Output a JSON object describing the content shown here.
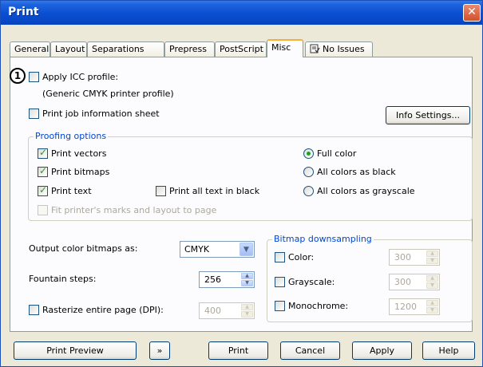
{
  "window": {
    "title": "Print",
    "close_glyph": "✕"
  },
  "tabs": [
    {
      "label": "General"
    },
    {
      "label": "Layout"
    },
    {
      "label": "Separations"
    },
    {
      "label": "Prepress"
    },
    {
      "label": "PostScript"
    },
    {
      "label": "Misc",
      "active": true
    },
    {
      "label": "No Issues",
      "icon": "issues-icon"
    }
  ],
  "marker": "1",
  "misc": {
    "apply_icc_label": "Apply ICC profile:",
    "apply_icc_checked": false,
    "icc_profile_name": "(Generic CMYK printer profile)",
    "print_job_info_label": "Print job information sheet",
    "print_job_info_checked": false,
    "info_settings_button": "Info Settings..."
  },
  "proofing": {
    "title": "Proofing options",
    "print_vectors": {
      "label": "Print vectors",
      "checked": true
    },
    "print_bitmaps": {
      "label": "Print bitmaps",
      "checked": true
    },
    "print_text": {
      "label": "Print text",
      "checked": true
    },
    "print_all_text_black": {
      "label": "Print all text in black",
      "checked": false
    },
    "fit_marks": {
      "label": "Fit printer's marks and layout to page",
      "checked": false,
      "disabled": true
    },
    "full_color": {
      "label": "Full color",
      "selected": true
    },
    "all_black": {
      "label": "All colors as black",
      "selected": false
    },
    "all_grayscale": {
      "label": "All colors as grayscale",
      "selected": false
    }
  },
  "output": {
    "bitmaps_label": "Output color bitmaps as:",
    "bitmaps_value": "CMYK",
    "fountain_label": "Fountain steps:",
    "fountain_value": "256",
    "rasterize_label": "Rasterize entire page (DPI):",
    "rasterize_checked": false,
    "rasterize_value": "400"
  },
  "downsampling": {
    "title": "Bitmap downsampling",
    "color": {
      "label": "Color:",
      "value": "300"
    },
    "grayscale": {
      "label": "Grayscale:",
      "value": "300"
    },
    "monochrome": {
      "label": "Monochrome:",
      "value": "1200"
    }
  },
  "footer": {
    "print_preview": "Print Preview",
    "preview_toggle_glyph": "»",
    "print": "Print",
    "cancel": "Cancel",
    "apply": "Apply",
    "help": "Help"
  }
}
